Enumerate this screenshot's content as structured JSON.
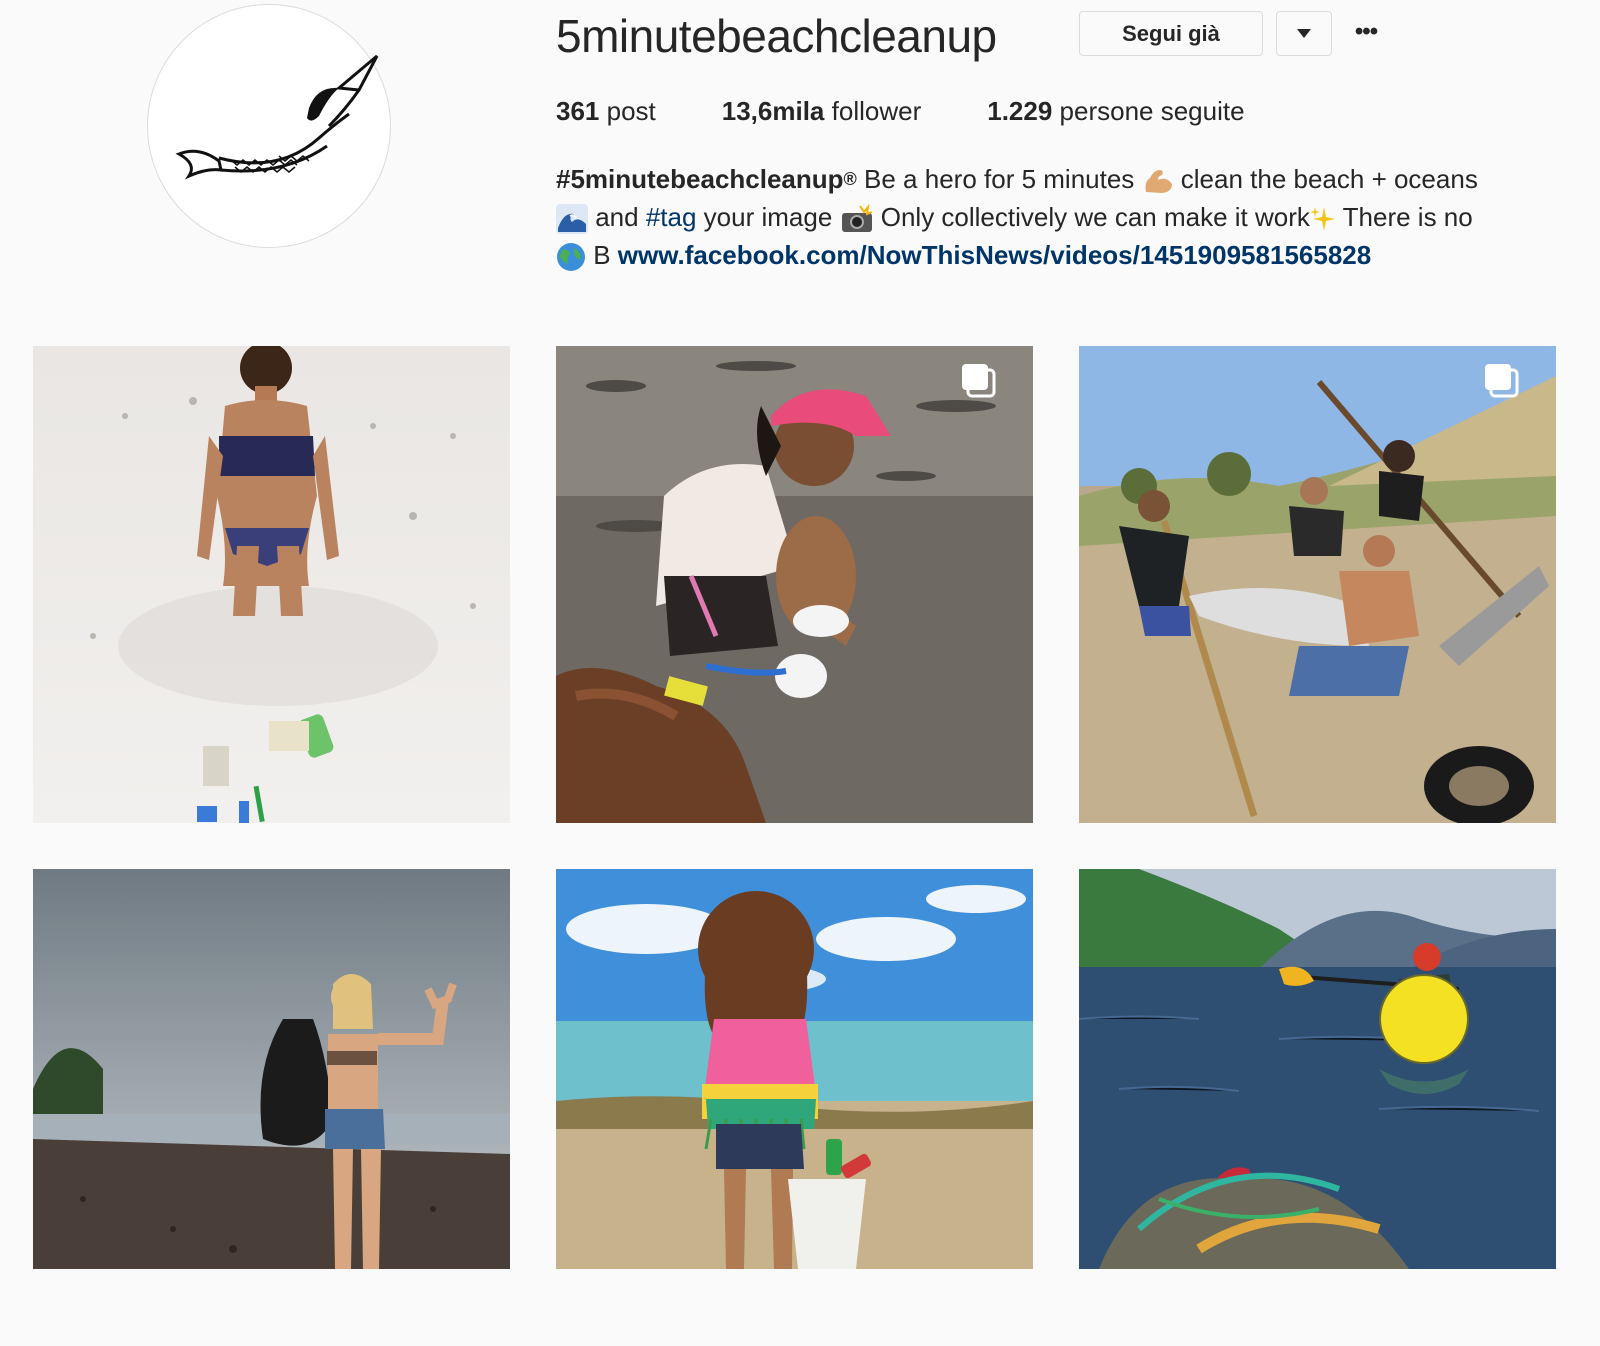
{
  "profile": {
    "username": "5minutebeachcleanup",
    "follow_label": "Segui già",
    "dropdown_icon": "caret-down-icon",
    "more_label": "•••"
  },
  "stats": [
    {
      "value": "361",
      "label": " post"
    },
    {
      "value": "13,6mila",
      "label": " follower"
    },
    {
      "value": "1.229",
      "label": " persone seguite"
    }
  ],
  "bio": {
    "handle": "#5minutebeachcleanup",
    "registered": "®",
    "line1_rest": " Be a hero for 5 minutes ",
    "line1_end": " clean the beach + oceans",
    "line2_a": " and ",
    "line2_tag": "#tag",
    "line2_b": " your image ",
    "line2_c": " Only collectively we can make it work",
    "line2_d": " There is no",
    "line3_a": " B ",
    "link": "www.facebook.com/NowThisNews/videos/1451909581565828"
  },
  "grid": {
    "posts": [
      {
        "name": "post-woman-kneeling-beach",
        "multi": false
      },
      {
        "name": "post-girl-pink-cap",
        "multi": true
      },
      {
        "name": "post-group-digging-sand",
        "multi": true
      },
      {
        "name": "post-woman-waving-beach",
        "multi": false
      },
      {
        "name": "post-girl-bucket-shore",
        "multi": false
      },
      {
        "name": "post-kayak-buoy",
        "multi": false
      }
    ]
  },
  "colors": {
    "link": "#003569",
    "border": "#dbdbdb",
    "background": "#fafafa"
  }
}
